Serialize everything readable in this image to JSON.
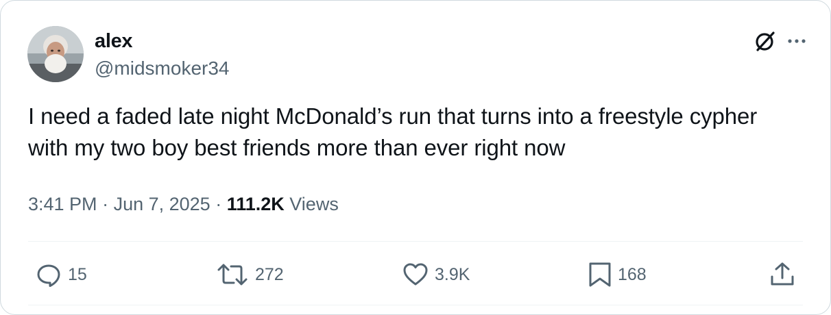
{
  "author": {
    "name": "alex",
    "handle": "@midsmoker34"
  },
  "tweet": {
    "text": "I need a faded late night McDonald’s run that turns into a freestyle cypher with my two boy best friends more than ever right now"
  },
  "meta": {
    "time": "3:41 PM",
    "separator_1": " · ",
    "date": "Jun 7, 2025",
    "separator_2": " · ",
    "views_count": "111.2K",
    "views_label": " Views"
  },
  "actions": {
    "replies": "15",
    "retweets": "272",
    "likes": "3.9K",
    "bookmarks": "168"
  },
  "icons": {
    "grok": "grok-icon",
    "more": "more-icon",
    "reply": "reply-icon",
    "retweet": "retweet-icon",
    "like": "heart-icon",
    "bookmark": "bookmark-icon",
    "share": "share-icon"
  },
  "colors": {
    "text": "#0f1419",
    "secondary": "#536471",
    "border": "#cfd9de",
    "divider": "#eff3f4"
  }
}
